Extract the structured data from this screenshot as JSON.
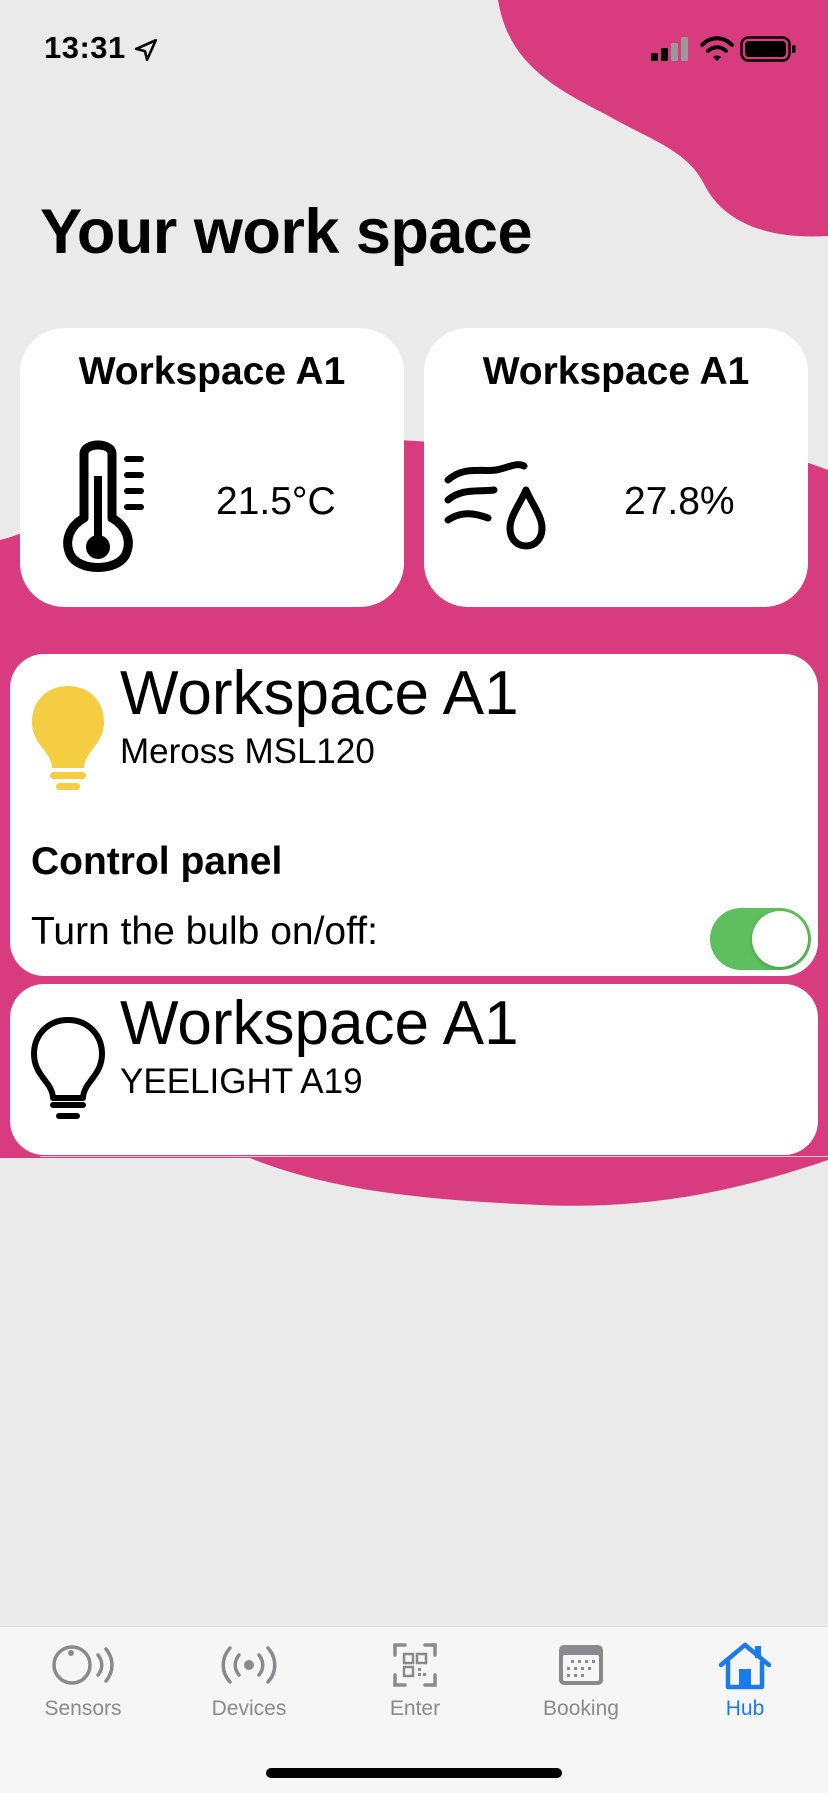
{
  "status_bar": {
    "time": "13:31",
    "icons": [
      "location-arrow-icon",
      "cellular-signal-icon",
      "wifi-icon",
      "battery-icon"
    ]
  },
  "page": {
    "title": "Your work space"
  },
  "colors": {
    "accent_blob": "#d93c7e",
    "toggle_on": "#5fbe5e",
    "active_tab": "#1a7aef",
    "bulb_on": "#f5cd43"
  },
  "sensors": [
    {
      "title": "Workspace A1",
      "icon": "thermometer-icon",
      "value": "21.5°C"
    },
    {
      "title": "Workspace A1",
      "icon": "humidity-icon",
      "value": "27.8%"
    }
  ],
  "devices": [
    {
      "name": "Workspace A1",
      "model": "Meross MSL120",
      "icon": "bulb-on-icon",
      "control_title": "Control panel",
      "toggle_label": "Turn the bulb on/off:",
      "toggle_on": true
    },
    {
      "name": "Workspace A1",
      "model": "YEELIGHT A19",
      "icon": "bulb-off-icon"
    }
  ],
  "tabs": [
    {
      "label": "Sensors",
      "icon": "sensor-icon",
      "active": false
    },
    {
      "label": "Devices",
      "icon": "broadcast-icon",
      "active": false
    },
    {
      "label": "Enter",
      "icon": "qr-code-icon",
      "active": false
    },
    {
      "label": "Booking",
      "icon": "calendar-icon",
      "active": false
    },
    {
      "label": "Hub",
      "icon": "home-icon",
      "active": true
    }
  ]
}
